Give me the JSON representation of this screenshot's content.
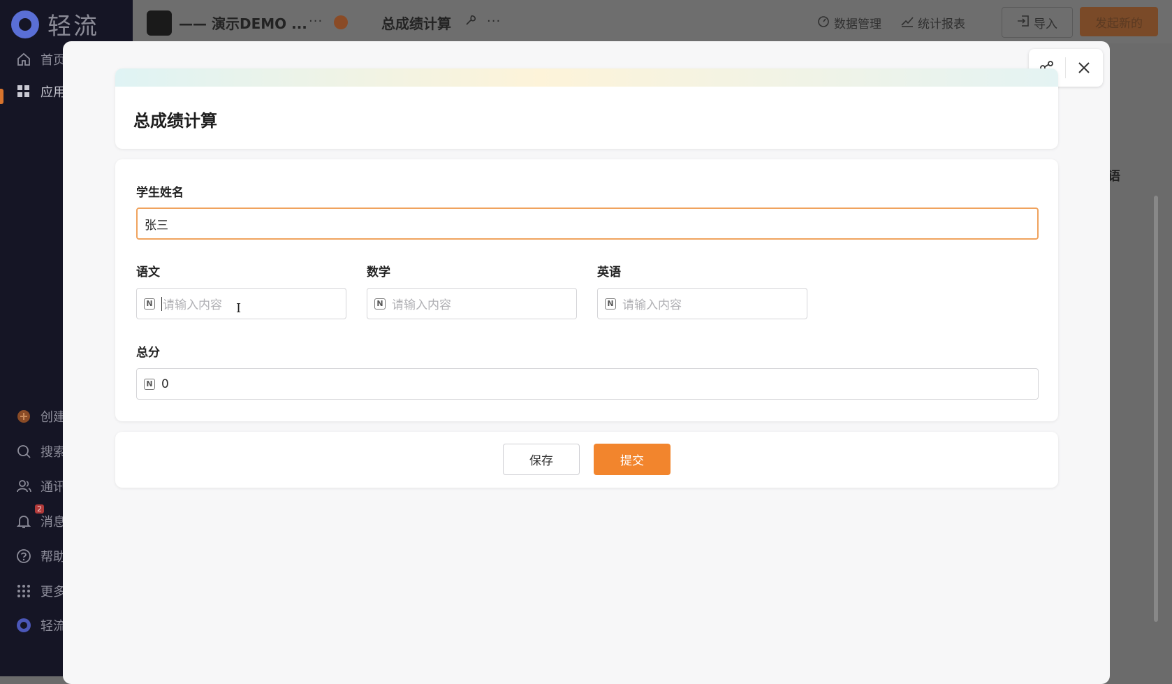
{
  "sidebar": {
    "logo_text": "轻流",
    "items": [
      {
        "label": "首页",
        "icon": "home-icon"
      },
      {
        "label": "应用",
        "icon": "apps-grid-icon",
        "active": true
      },
      {
        "label": "创建",
        "icon": "create-dot-icon"
      },
      {
        "label": "搜索",
        "icon": "search-icon"
      },
      {
        "label": "通讯",
        "icon": "contacts-icon"
      },
      {
        "label": "消息",
        "icon": "bell-icon",
        "badge": "2"
      },
      {
        "label": "帮助",
        "icon": "help-icon"
      },
      {
        "label": "更多",
        "icon": "more-grid-icon"
      },
      {
        "label": "轻流",
        "icon": "logo-small-icon"
      }
    ]
  },
  "header": {
    "app_name": "—— 演示DEMO ...",
    "more_label": "···",
    "form_name": "总成绩计算",
    "data_manage": "数据管理",
    "stats_report": "统计报表",
    "import_label": "导入",
    "start_label": "发起新的"
  },
  "background": {
    "fragment": "语"
  },
  "modal": {
    "title": "总成绩计算",
    "fields": {
      "student_name": {
        "label": "学生姓名",
        "value": "张三"
      },
      "chinese": {
        "label": "语文",
        "placeholder": "请输入内容"
      },
      "math": {
        "label": "数学",
        "placeholder": "请输入内容"
      },
      "english": {
        "label": "英语",
        "placeholder": "请输入内容"
      },
      "total": {
        "label": "总分",
        "value": "0"
      }
    },
    "number_icon_glyph": "N",
    "save_label": "保存",
    "submit_label": "提交"
  },
  "colors": {
    "accent": "#f2852d",
    "focus_border": "#f0a35e",
    "sidebar_bg": "#151525"
  }
}
